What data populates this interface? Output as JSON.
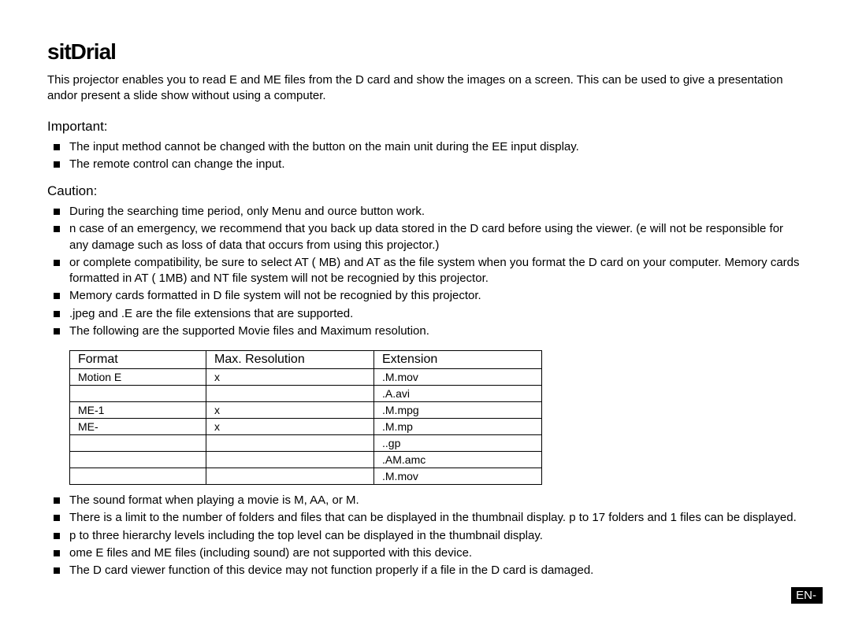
{
  "title": "sitDrial",
  "intro": "This projector enables you to read E and ME files from the D card and show the images on a screen. This can be used to give a presentation andor present a slide show without using a computer.",
  "important": {
    "label": "Important:",
    "items": [
      "The input method cannot be changed with the button on the main unit during the  EE input display.",
      "The remote control can change the input."
    ]
  },
  "caution": {
    "label": "Caution:",
    "items_a": [
      "During the searching time period, only Menu and ource button work.",
      "n case of an emergency, we recommend that you back up data stored in the D card before using the viewer. (e will not be responsible for any damage such as loss of data that occurs from using this projector.)",
      "or complete compatibility, be sure to select AT  ( MB) and AT as the file system when you format the D card on your computer. Memory cards formatted in AT  ( 1MB) and NT file system will not be recognied by this projector.",
      "Memory cards formatted in D file system will not be recognied by this projector.",
      ".jpeg and .E are the file extensions that are supported.",
      "The following are the supported Movie files and Maximum resolution."
    ],
    "items_b": [
      "The sound format when playing a movie is M, AA, or M.",
      "There is a limit to the number of folders and files that can be displayed in the thumbnail display. p to 17 folders and 1 files can be displayed.",
      "p to three hierarchy levels including the top level can be displayed in the thumbnail display.",
      "ome E files and ME files (including sound) are not supported with this device.",
      "The D card viewer function of this device may not function properly if a file in the D card is damaged."
    ]
  },
  "table": {
    "headers": {
      "format": "Format",
      "res": "Max. Resolution",
      "ext": "Extension"
    },
    "rows": [
      {
        "format": "Motion E",
        "res": " x ",
        "ext": ".M.mov"
      },
      {
        "format": "",
        "res": "",
        "ext": ".A.avi"
      },
      {
        "format": "ME-1",
        "res": " x ",
        "ext": ".M.mpg"
      },
      {
        "format": "ME-",
        "res": " x ",
        "ext": ".M.mp"
      },
      {
        "format": "",
        "res": "",
        "ext": "..gp"
      },
      {
        "format": "",
        "res": "",
        "ext": ".AM.amc"
      },
      {
        "format": "",
        "res": "",
        "ext": ".M.mov"
      }
    ]
  },
  "page_number": "EN-"
}
